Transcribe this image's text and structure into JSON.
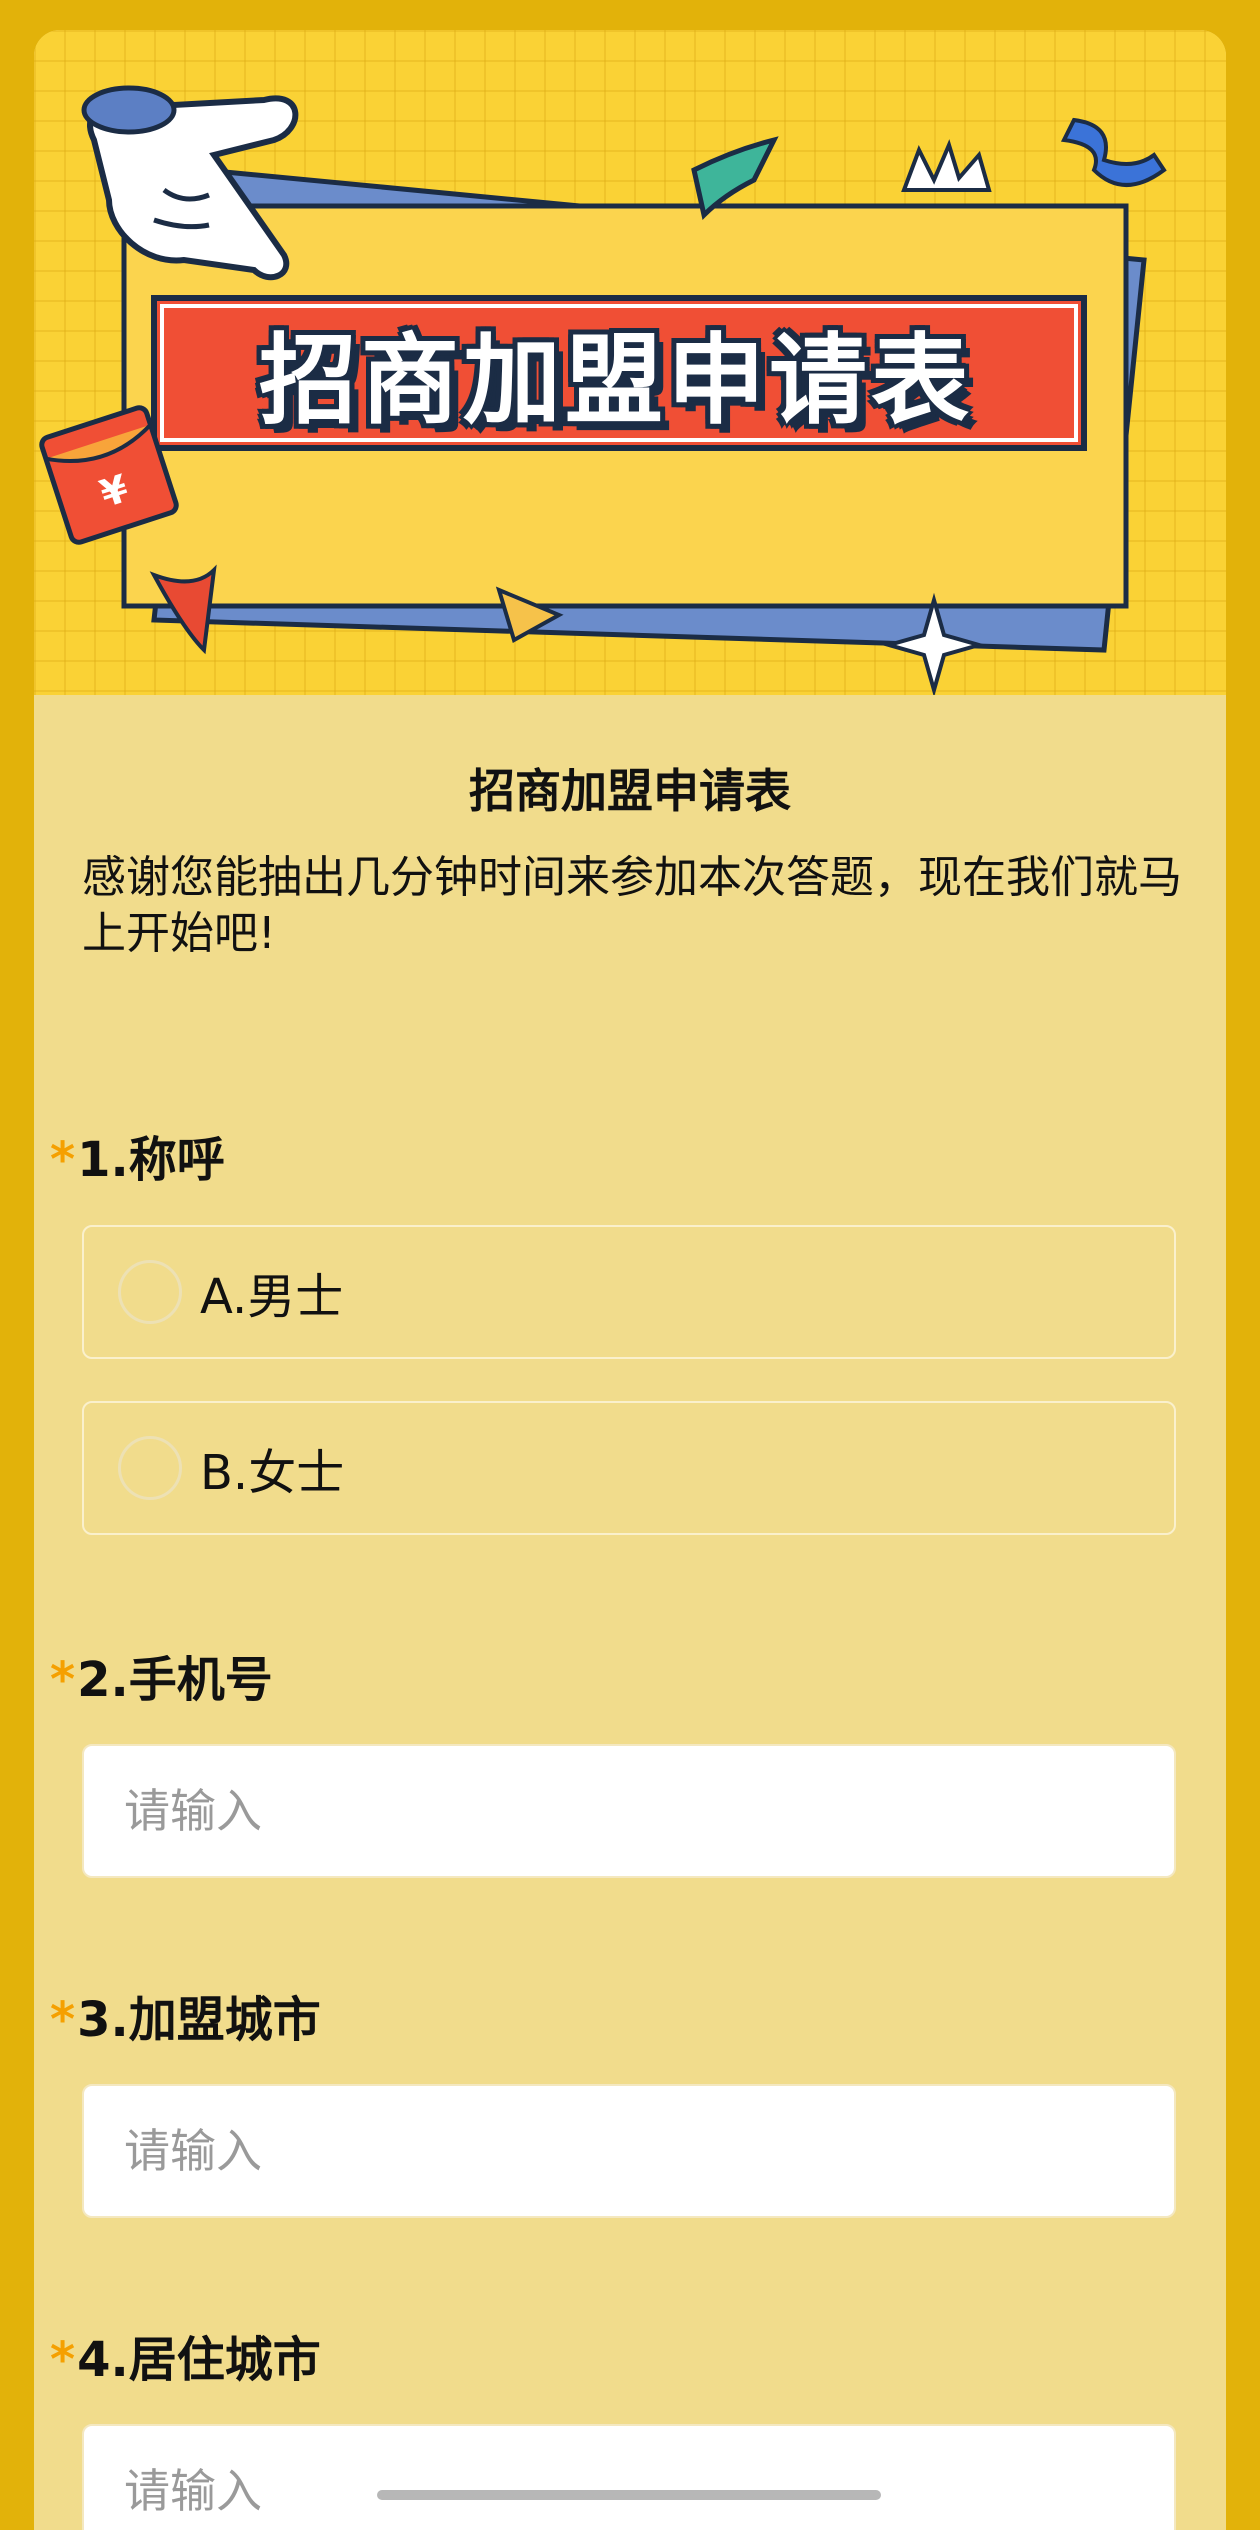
{
  "banner": {
    "title": "招商加盟申请表",
    "coin_icon": "¥"
  },
  "form": {
    "title": "招商加盟申请表",
    "description": "感谢您能抽出几分钟时间来参加本次答题，现在我们就马上开始吧!",
    "required_mark": "*",
    "questions": [
      {
        "label": "1.称呼",
        "options": [
          "A.男士",
          "B.女士"
        ]
      },
      {
        "label": "2.手机号",
        "placeholder": "请输入"
      },
      {
        "label": "3.加盟城市",
        "placeholder": "请输入"
      },
      {
        "label": "4.居住城市",
        "placeholder": "请输入"
      }
    ]
  },
  "colors": {
    "frame": "#E2B20A",
    "card": "#F1DC8C",
    "banner": "#FAD235",
    "title_red": "#F04F35",
    "required": "#F5A000"
  },
  "icons": [
    "pointing-hand-icon",
    "red-envelope-icon",
    "sparkle-icon",
    "confetti-icon"
  ]
}
